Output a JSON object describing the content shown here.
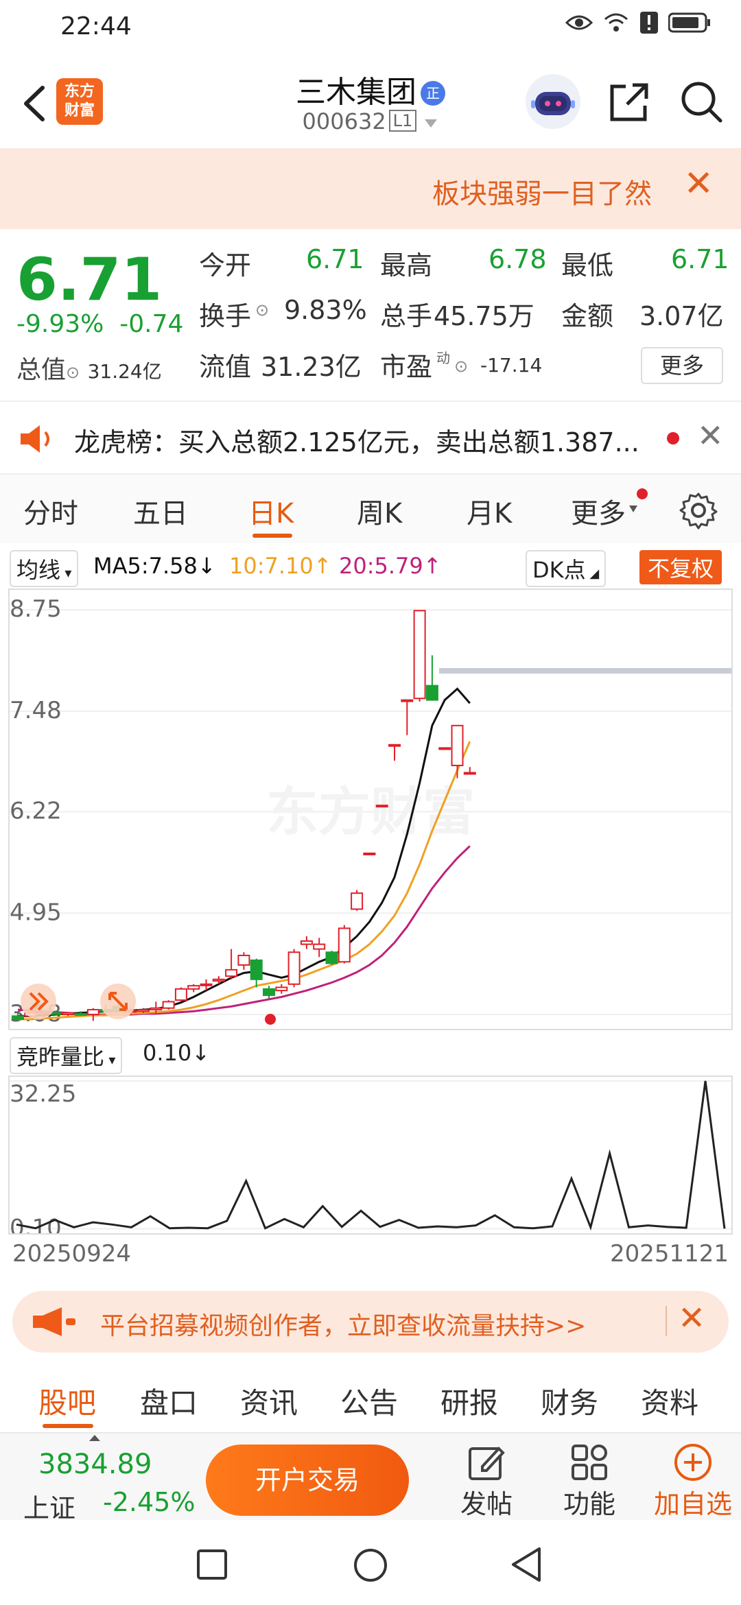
{
  "status": {
    "time": "22:44"
  },
  "header": {
    "logo_line1": "东方",
    "logo_line2": "财富",
    "stock_name": "三木集团",
    "badge": "正",
    "stock_code": "000632",
    "level": "L1"
  },
  "banner": {
    "text": "板块强弱一目了然"
  },
  "quote": {
    "price": "6.71",
    "change_pct": "-9.93%",
    "change_abs": "-0.74",
    "total_value_label": "总值",
    "total_value": "31.24亿",
    "open_label": "今开",
    "open": "6.71",
    "high_label": "最高",
    "high": "6.78",
    "low_label": "最低",
    "low": "6.71",
    "turnover_label": "换手",
    "turnover": "9.83%",
    "volume_label": "总手",
    "volume": "45.75万",
    "amount_label": "金额",
    "amount": "3.07亿",
    "float_label": "流值",
    "float_value": "31.23亿",
    "pe_label": "市盈",
    "pe_super": "动",
    "pe": "-17.14",
    "more": "更多"
  },
  "dragon": {
    "text": "龙虎榜：买入总额2.125亿元，卖出总额1.387..."
  },
  "chart_tabs": [
    "分时",
    "五日",
    "日K",
    "周K",
    "月K",
    "更多"
  ],
  "chart_tab_active": 2,
  "ma_row": {
    "avg_label": "均线",
    "ma5": "MA5:7.58↓",
    "ma10": "10:7.10↑",
    "ma20": "20:5.79↑",
    "dk": "DK点",
    "adjust": "不复权",
    "colors": {
      "ma5": "#111111",
      "ma10": "#f0a020",
      "ma20": "#c0207a",
      "up": "#e0202a",
      "down": "#19a032"
    }
  },
  "volume_row": {
    "label": "竞昨量比",
    "value": "0.10↓"
  },
  "watermark": "东方财富",
  "chart_data": [
    {
      "type": "candlestick",
      "y_ticks": [
        "8.75",
        "7.48",
        "6.22",
        "4.95",
        "3.68"
      ],
      "ylim": [
        3.5,
        9.0
      ],
      "candles": [
        {
          "o": 3.66,
          "h": 3.7,
          "l": 3.6,
          "c": 3.62
        },
        {
          "o": 3.66,
          "h": 3.72,
          "l": 3.64,
          "c": 3.7
        },
        {
          "o": 3.7,
          "h": 3.74,
          "l": 3.66,
          "c": 3.71
        },
        {
          "o": 3.7,
          "h": 3.73,
          "l": 3.68,
          "c": 3.69
        },
        {
          "o": 3.68,
          "h": 3.71,
          "l": 3.66,
          "c": 3.7
        },
        {
          "o": 3.69,
          "h": 3.72,
          "l": 3.67,
          "c": 3.68
        },
        {
          "o": 3.68,
          "h": 3.76,
          "l": 3.6,
          "c": 3.74
        },
        {
          "o": 3.74,
          "h": 3.8,
          "l": 3.7,
          "c": 3.72
        },
        {
          "o": 3.78,
          "h": 3.84,
          "l": 3.7,
          "c": 3.72
        },
        {
          "o": 3.72,
          "h": 3.76,
          "l": 3.68,
          "c": 3.73
        },
        {
          "o": 3.72,
          "h": 3.76,
          "l": 3.7,
          "c": 3.74
        },
        {
          "o": 3.74,
          "h": 3.84,
          "l": 3.7,
          "c": 3.76
        },
        {
          "o": 3.76,
          "h": 3.86,
          "l": 3.74,
          "c": 3.84
        },
        {
          "o": 3.86,
          "h": 4.02,
          "l": 3.84,
          "c": 4.0
        },
        {
          "o": 4.0,
          "h": 4.06,
          "l": 3.96,
          "c": 4.04
        },
        {
          "o": 4.06,
          "h": 4.12,
          "l": 3.98,
          "c": 4.06
        },
        {
          "o": 4.1,
          "h": 4.16,
          "l": 4.06,
          "c": 4.12
        },
        {
          "o": 4.16,
          "h": 4.5,
          "l": 4.12,
          "c": 4.24
        },
        {
          "o": 4.3,
          "h": 4.46,
          "l": 4.24,
          "c": 4.42
        },
        {
          "o": 4.36,
          "h": 4.38,
          "l": 4.02,
          "c": 4.12
        },
        {
          "o": 4.0,
          "h": 4.04,
          "l": 3.88,
          "c": 3.92
        },
        {
          "o": 3.98,
          "h": 4.06,
          "l": 3.94,
          "c": 4.02
        },
        {
          "o": 4.06,
          "h": 4.5,
          "l": 4.02,
          "c": 4.46
        },
        {
          "o": 4.56,
          "h": 4.66,
          "l": 4.5,
          "c": 4.6
        },
        {
          "o": 4.5,
          "h": 4.64,
          "l": 4.4,
          "c": 4.56
        },
        {
          "o": 4.46,
          "h": 4.48,
          "l": 4.3,
          "c": 4.32
        },
        {
          "o": 4.34,
          "h": 4.8,
          "l": 4.32,
          "c": 4.76
        },
        {
          "o": 5.0,
          "h": 5.24,
          "l": 4.98,
          "c": 5.2
        },
        {
          "o": 5.7,
          "h": 5.7,
          "l": 5.7,
          "c": 5.7
        },
        {
          "o": 6.3,
          "h": 6.3,
          "l": 6.3,
          "c": 6.3
        },
        {
          "o": 7.06,
          "h": 7.06,
          "l": 6.86,
          "c": 7.06
        },
        {
          "o": 7.62,
          "h": 7.62,
          "l": 7.18,
          "c": 7.62
        },
        {
          "o": 7.64,
          "h": 8.74,
          "l": 7.6,
          "c": 8.74
        },
        {
          "o": 7.8,
          "h": 8.18,
          "l": 7.62,
          "c": 7.62
        },
        {
          "o": 7.02,
          "h": 7.02,
          "l": 7.02,
          "c": 7.02
        },
        {
          "o": 6.8,
          "h": 7.3,
          "l": 6.64,
          "c": 7.3
        },
        {
          "o": 6.71,
          "h": 6.78,
          "l": 6.71,
          "c": 6.71
        }
      ],
      "ma5": [
        3.66,
        3.66,
        3.67,
        3.68,
        3.69,
        3.7,
        3.71,
        3.72,
        3.72,
        3.73,
        3.74,
        3.75,
        3.78,
        3.83,
        3.9,
        3.98,
        4.06,
        4.14,
        4.2,
        4.22,
        4.18,
        4.14,
        4.18,
        4.26,
        4.34,
        4.4,
        4.52,
        4.66,
        4.84,
        5.08,
        5.4,
        5.94,
        6.58,
        7.3,
        7.62,
        7.76,
        7.58
      ],
      "ma10": [
        3.62,
        3.62,
        3.63,
        3.64,
        3.65,
        3.66,
        3.67,
        3.67,
        3.68,
        3.69,
        3.7,
        3.71,
        3.72,
        3.74,
        3.77,
        3.81,
        3.86,
        3.92,
        3.98,
        4.04,
        4.07,
        4.1,
        4.13,
        4.18,
        4.24,
        4.3,
        4.36,
        4.44,
        4.56,
        4.72,
        4.92,
        5.2,
        5.56,
        5.98,
        6.36,
        6.74,
        7.1
      ],
      "ma20": [
        3.74,
        3.73,
        3.72,
        3.71,
        3.7,
        3.69,
        3.68,
        3.68,
        3.68,
        3.68,
        3.69,
        3.69,
        3.7,
        3.71,
        3.72,
        3.74,
        3.76,
        3.78,
        3.81,
        3.84,
        3.87,
        3.9,
        3.94,
        3.98,
        4.03,
        4.08,
        4.14,
        4.21,
        4.3,
        4.42,
        4.58,
        4.78,
        5.02,
        5.26,
        5.46,
        5.64,
        5.79
      ]
    },
    {
      "type": "line",
      "name": "竞昨量比",
      "y_ticks": [
        "32.25",
        "0.10"
      ],
      "ylim": [
        0,
        32.25
      ],
      "values": [
        1.0,
        0.2,
        2.0,
        0.4,
        1.5,
        1.0,
        0.4,
        2.8,
        0.2,
        0.3,
        0.2,
        1.8,
        10.5,
        0.2,
        2.2,
        0.4,
        5.0,
        0.5,
        4.0,
        0.5,
        2.0,
        0.3,
        0.6,
        0.4,
        0.8,
        3.0,
        0.4,
        0.2,
        0.6,
        11.0,
        0.4,
        16.5,
        0.4,
        0.8,
        0.5,
        0.3,
        32.25,
        0.1
      ]
    }
  ],
  "dates": {
    "start": "20250924",
    "end": "20251121"
  },
  "promo": {
    "text": "平台招募视频创作者，立即查收流量扶持>>"
  },
  "bottom_tabs": [
    "股吧",
    "盘口",
    "资讯",
    "公告",
    "研报",
    "财务",
    "资料"
  ],
  "bottom_tab_active": 0,
  "footer": {
    "index_value": "3834.89",
    "index_name": "上证",
    "index_change": "-2.45%",
    "trade": "开户交易",
    "post": "发帖",
    "functions": "功能",
    "add_watch": "加自选"
  }
}
